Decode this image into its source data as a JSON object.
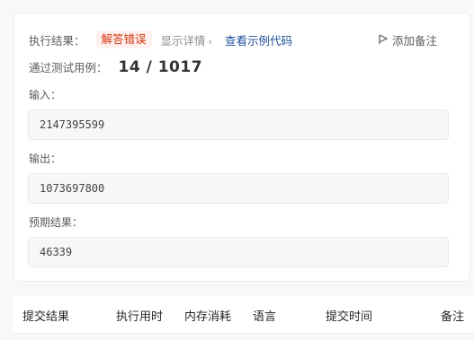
{
  "result": {
    "label": "执行结果：",
    "status": "解答错误",
    "details_link": "显示详情",
    "details_chevron": "›",
    "example_code_link": "查看示例代码",
    "add_note": "添加备注"
  },
  "pass": {
    "label": "通过测试用例：",
    "count": "14 / 1017"
  },
  "input": {
    "label": "输入：",
    "value": "2147395599"
  },
  "output": {
    "label": "输出：",
    "value": "1073697800"
  },
  "expected": {
    "label": "预期结果：",
    "value": "46339"
  },
  "table": {
    "headers": [
      "提交结果",
      "执行用时",
      "内存消耗",
      "语言",
      "提交时间",
      "备注"
    ]
  },
  "colors": {
    "error_badge_bg": "#fff1f0",
    "error_badge_text": "#d4380d",
    "link": "#1f4f9a"
  }
}
